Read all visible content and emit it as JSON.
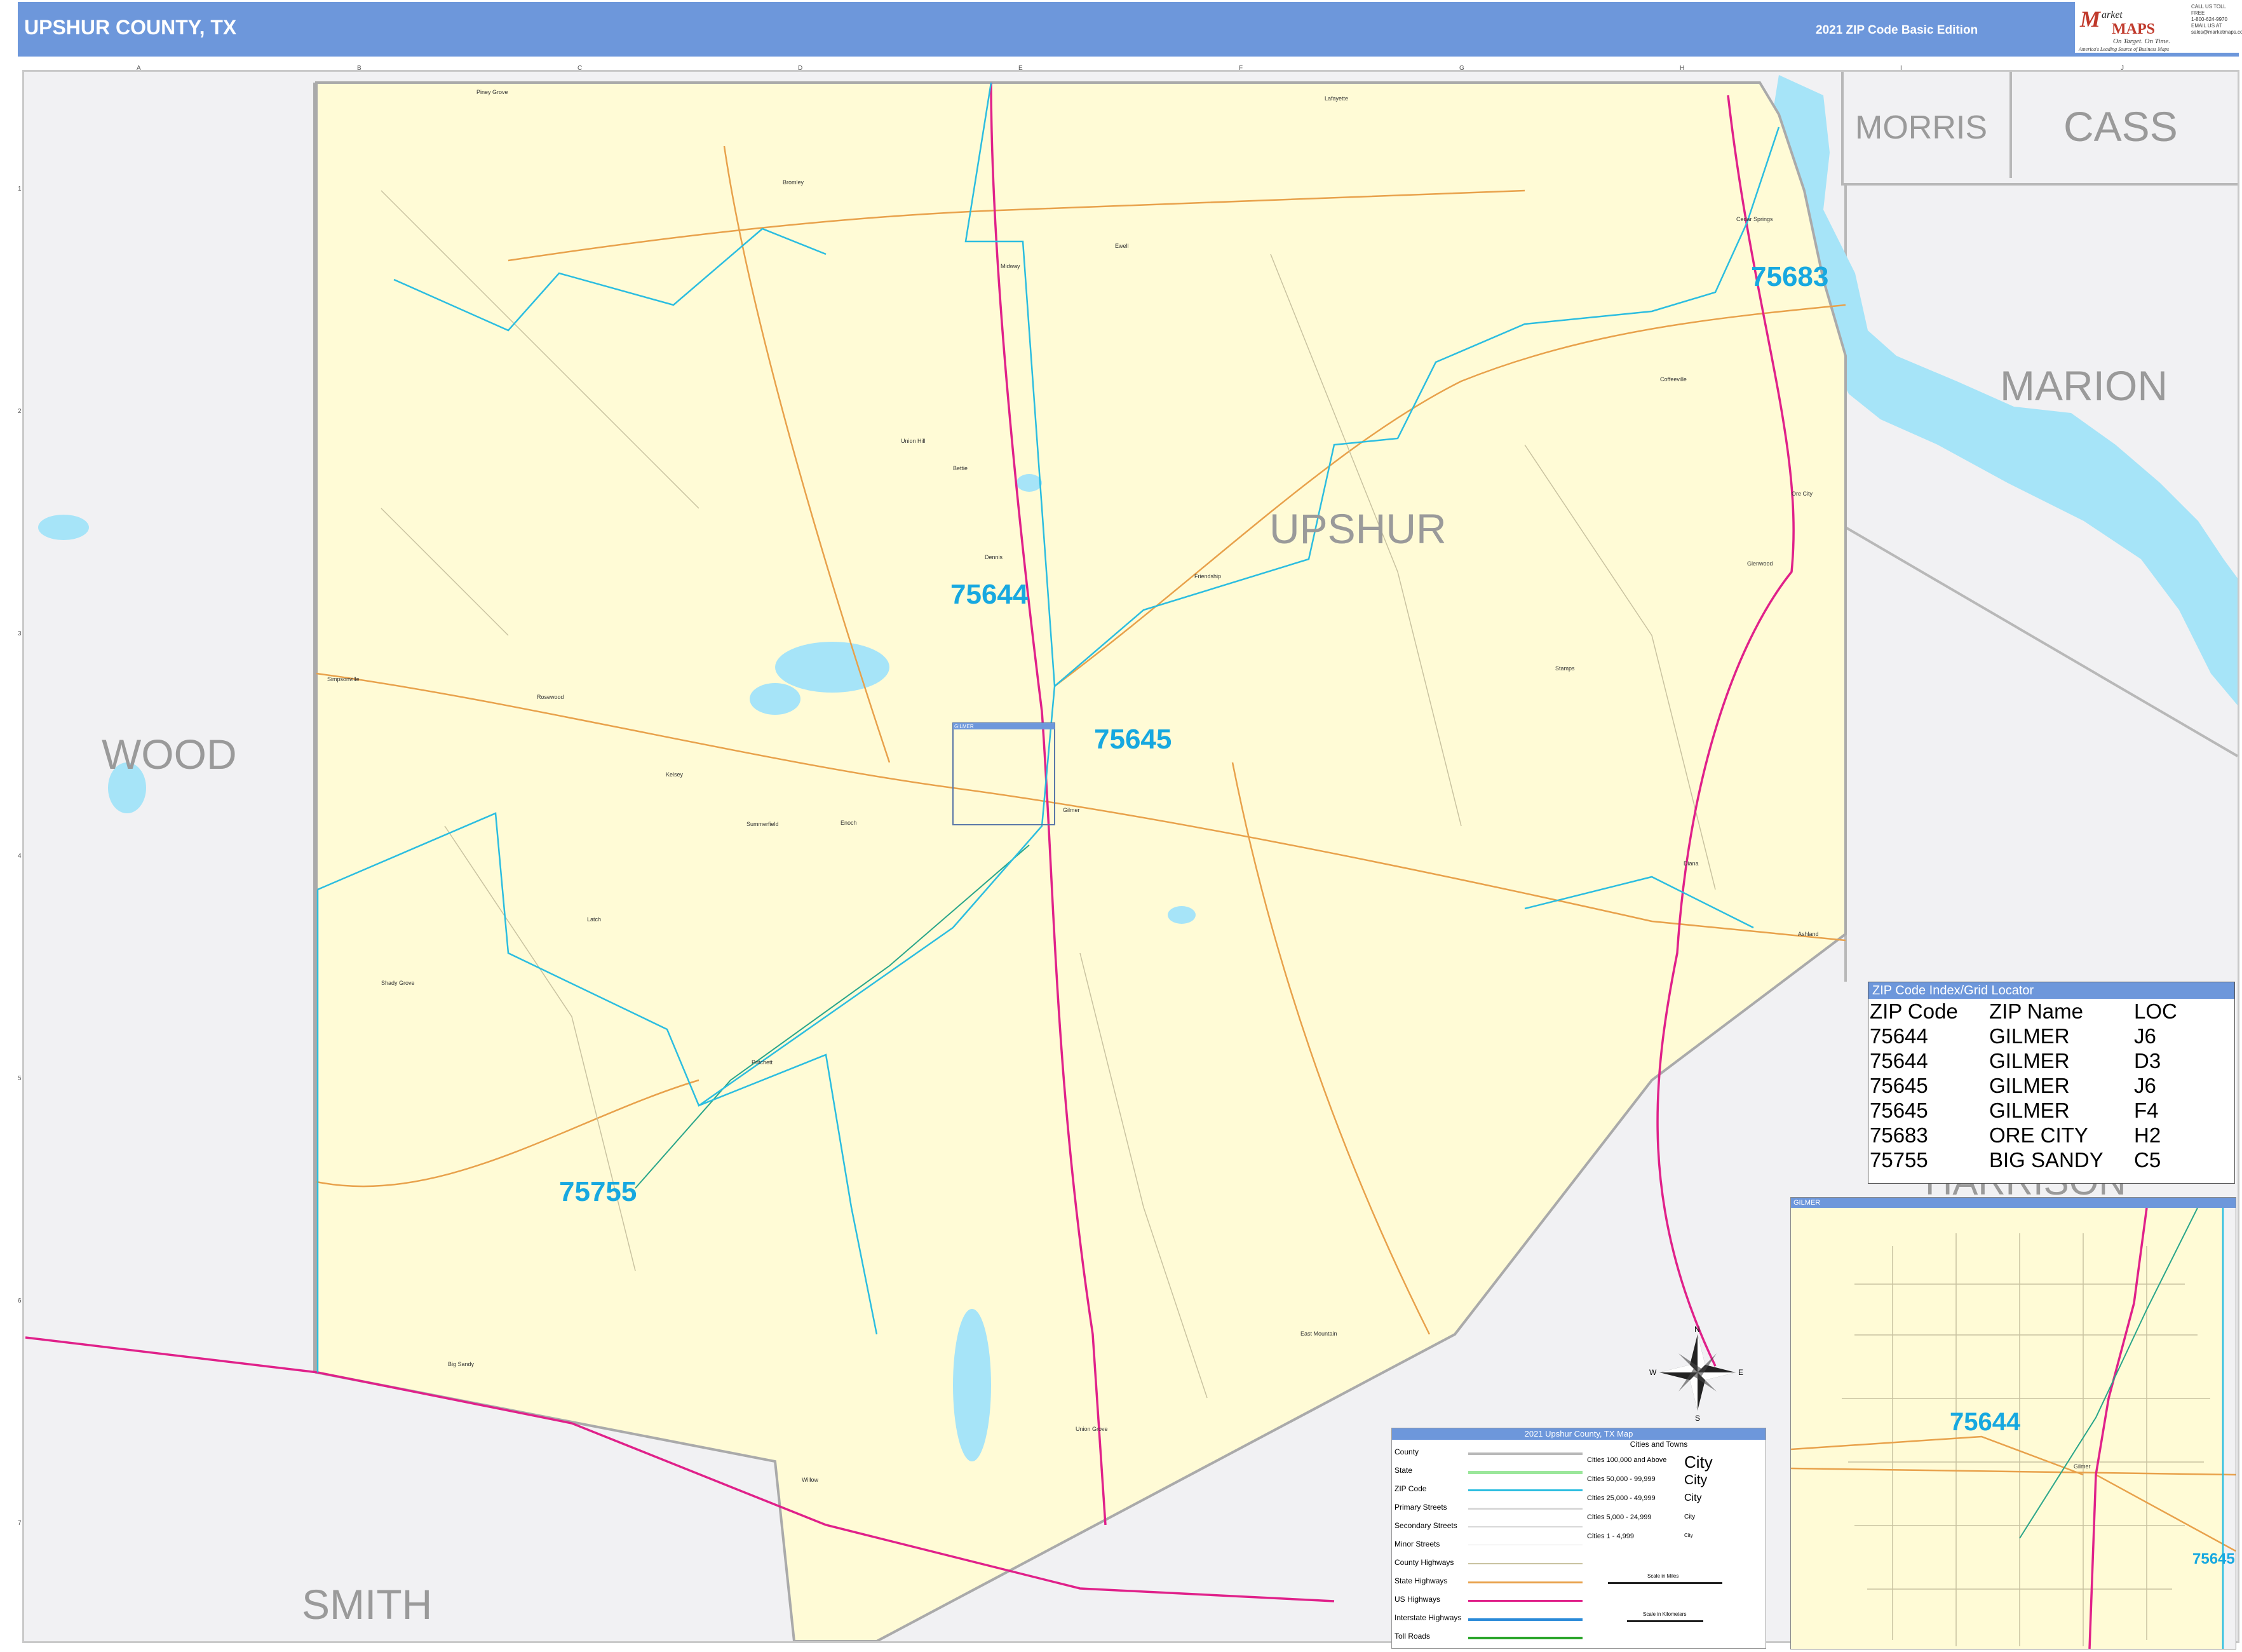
{
  "header": {
    "title": "UPSHUR COUNTY, TX",
    "edition": "2021 ZIP Code Basic Edition"
  },
  "logo": {
    "brand_initial": "M",
    "brand_top": "arket",
    "brand_bottom": "MAPS",
    "tagline": "On Target. On Time.",
    "slogan": "America's Leading Source of Business Maps"
  },
  "contact": {
    "line1": "CALL US TOLL FREE",
    "line2": "1-800-624-9970",
    "line3": "EMAIL US AT",
    "line4": "sales@marketmaps.com"
  },
  "grid": {
    "columns": [
      "A",
      "B",
      "C",
      "D",
      "E",
      "F",
      "G",
      "H",
      "I",
      "J"
    ],
    "rows": [
      "1",
      "2",
      "3",
      "4",
      "5",
      "6",
      "7"
    ]
  },
  "counties": {
    "upshur": "UPSHUR",
    "morris": "MORRIS",
    "cass": "CASS",
    "marion": "MARION",
    "wood": "WOOD",
    "smith": "SMITH",
    "harrison": "HARRISON"
  },
  "zip_labels": {
    "z75644": "75644",
    "z75645": "75645",
    "z75683": "75683",
    "z75755": "75755"
  },
  "towns": [
    "Piney Grove",
    "Lafayette",
    "Bromley",
    "Midway",
    "Ewell",
    "Cedar Springs",
    "Coffeeville",
    "Union Hill",
    "Bettie",
    "Ore City",
    "Glenwood",
    "Simpsonville",
    "Dennis",
    "Friendship",
    "Rosewood",
    "Kelsey",
    "Summerfield",
    "Enoch",
    "Shady Grove",
    "Pritchett",
    "East Mountain",
    "Latch",
    "Big Sandy",
    "Union Grove",
    "Willow",
    "Ashland",
    "Diana",
    "Stamps",
    "Gilmer"
  ],
  "inset_box_label": "GILMER",
  "inset": {
    "header": "GILMER",
    "zip_main": "75644",
    "zip_edge": "75645",
    "town": "Gilmer"
  },
  "zip_index": {
    "header": "ZIP Code Index/Grid Locator",
    "columns": [
      "ZIP Code",
      "ZIP Name",
      "LOC"
    ],
    "rows": [
      [
        "75644",
        "GILMER",
        "J6"
      ],
      [
        "75644",
        "GILMER",
        "D3"
      ],
      [
        "75645",
        "GILMER",
        "J6"
      ],
      [
        "75645",
        "GILMER",
        "F4"
      ],
      [
        "75683",
        "ORE CITY",
        "H2"
      ],
      [
        "75755",
        "BIG SANDY",
        "C5"
      ]
    ]
  },
  "legend": {
    "title": "2021 Upshur County, TX Map",
    "cities_heading": "Cities and Towns",
    "items": [
      "County",
      "State",
      "ZIP Code",
      "Primary Streets",
      "Secondary Streets",
      "Minor Streets",
      "County Highways",
      "State Highways",
      "US Highways",
      "Interstate Highways",
      "Toll Roads"
    ],
    "city_classes": [
      "Cities 100,000 and Above",
      "Cities 50,000 - 99,999",
      "Cities 25,000 - 49,999",
      "Cities 5,000 - 24,999",
      "Cities 1 - 4,999"
    ],
    "city_samples": [
      "City",
      "City",
      "City",
      "City",
      "City"
    ],
    "scale_miles": "Scale in Miles",
    "scale_km": "Scale in Kilometers"
  },
  "compass": {
    "n": "N",
    "s": "S",
    "e": "E",
    "w": "W"
  },
  "colors": {
    "header_bar": "#6d97db",
    "county_fill": "#fffbd6",
    "outside_fill": "#f1f1f3",
    "water": "#a6e4f8",
    "zip_boundary": "#2bbde0",
    "zip_label": "#17a8e0",
    "us_highway": "#e0218a",
    "state_highway": "#e8a14b",
    "county_label": "#9a9a9a"
  }
}
